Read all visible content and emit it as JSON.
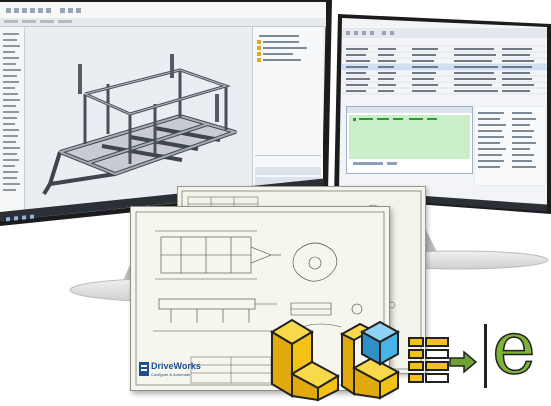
{
  "colors": {
    "monitor_bezel": "#1c1c1c",
    "stand": "#d9d9d9",
    "cad_background": "#e9edf2",
    "sheet_paper": "#f3f3ea",
    "logo_yellow": "#f2c316",
    "logo_blue": "#49b3e8",
    "logo_green": "#6ca332",
    "drive_works_blue": "#1d4f91"
  },
  "drawing_sheet": {
    "brand_name": "DriveWorks",
    "brand_tagline": "Configure & Automate"
  },
  "monitor_left": {
    "app": "3D CAD modelling software",
    "icons": [
      "trailer-chassis-model",
      "feature-tree",
      "taskbar"
    ]
  },
  "monitor_right": {
    "app": "DriveWorks data tables",
    "icons": [
      "table-grid",
      "green-form-preview"
    ]
  },
  "logo": {
    "icons": [
      "l-bracket-yellow-icon",
      "cube-blue-icon",
      "form-arrow-icon",
      "e-icon"
    ],
    "letter": "e"
  }
}
